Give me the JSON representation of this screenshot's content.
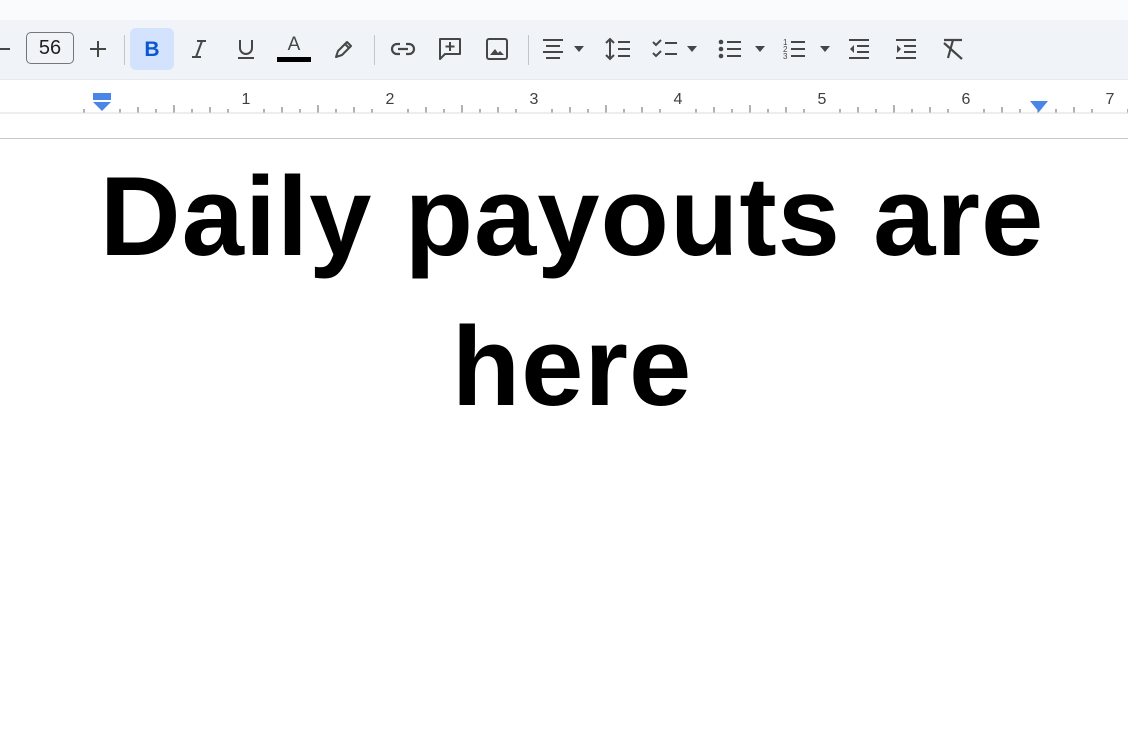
{
  "toolbar": {
    "font_size": "56",
    "text_color": "#000000",
    "active_accent": "#d3e3fd",
    "icons": [
      "decrease-font-size-icon",
      "increase-font-size-icon",
      "bold-icon",
      "italic-icon",
      "underline-icon",
      "text-color-icon",
      "highlight-icon",
      "insert-link-icon",
      "add-comment-icon",
      "insert-image-icon",
      "align-center-icon",
      "line-spacing-icon",
      "checklist-icon",
      "bulleted-list-icon",
      "numbered-list-icon",
      "decrease-indent-icon",
      "increase-indent-icon",
      "clear-formatting-icon"
    ],
    "bold_active": true
  },
  "ruler": {
    "labels": [
      "1",
      "2",
      "3",
      "4",
      "5",
      "6",
      "7"
    ],
    "marker_color": "#4a86e8"
  },
  "document": {
    "heading": "Daily payouts are here"
  }
}
